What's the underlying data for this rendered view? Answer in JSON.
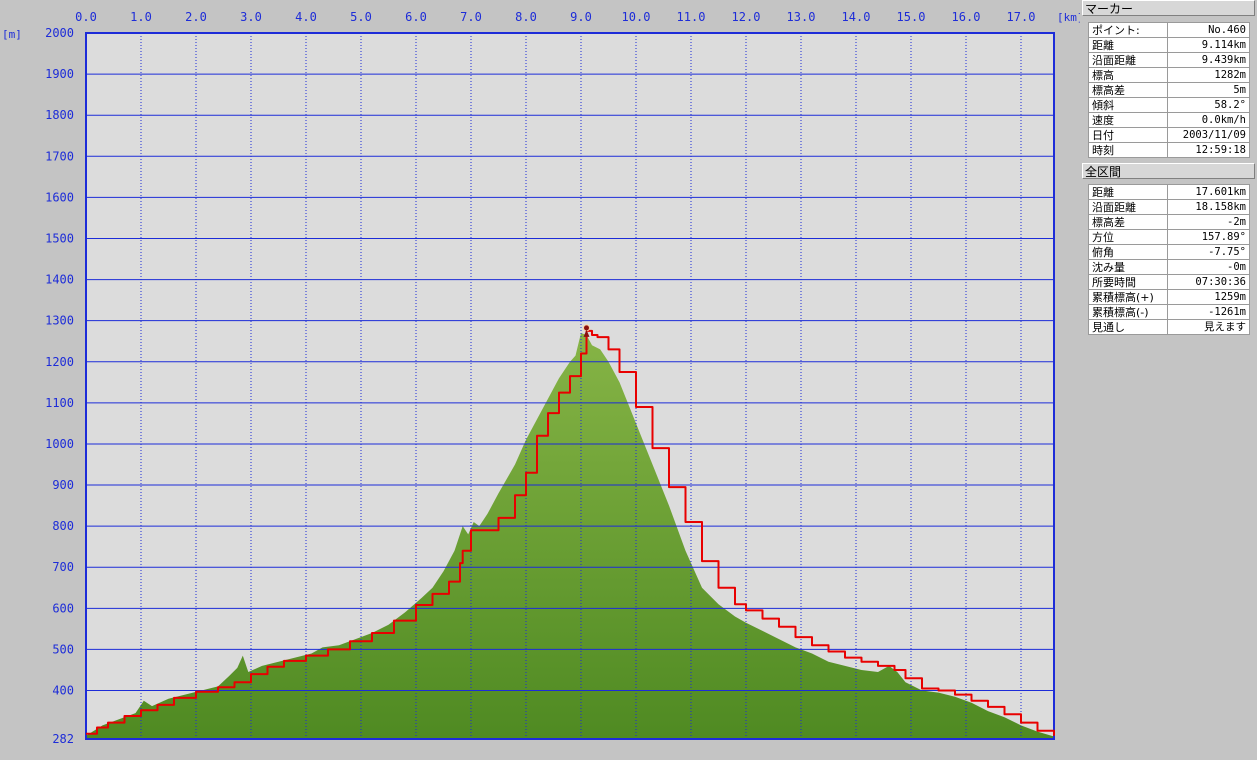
{
  "chart_data": {
    "type": "area",
    "x_unit": "[km]",
    "y_unit": "[m]",
    "xlim": [
      0.0,
      17.6
    ],
    "ylim": [
      282,
      2000
    ],
    "x_ticks": [
      "0.0",
      "1.0",
      "2.0",
      "3.0",
      "4.0",
      "5.0",
      "6.0",
      "7.0",
      "8.0",
      "9.0",
      "10.0",
      "11.0",
      "12.0",
      "13.0",
      "14.0",
      "15.0",
      "16.0",
      "17.0"
    ],
    "y_ticks": [
      "2000",
      "1900",
      "1800",
      "1700",
      "1600",
      "1500",
      "1400",
      "1300",
      "1200",
      "1100",
      "1000",
      "900",
      "800",
      "700",
      "600",
      "500",
      "400",
      "282"
    ],
    "grid": true,
    "terrain": {
      "color": "#5e9530",
      "x": [
        0.0,
        0.3,
        0.6,
        0.9,
        1.05,
        1.2,
        1.5,
        1.8,
        2.1,
        2.4,
        2.6,
        2.75,
        2.85,
        2.95,
        3.2,
        3.5,
        3.8,
        4.1,
        4.3,
        4.6,
        4.9,
        5.2,
        5.5,
        5.8,
        6.1,
        6.3,
        6.5,
        6.7,
        6.85,
        6.95,
        7.05,
        7.15,
        7.3,
        7.5,
        7.8,
        8.0,
        8.2,
        8.4,
        8.6,
        8.8,
        8.9,
        9.0,
        9.1,
        9.2,
        9.35,
        9.5,
        9.7,
        10.0,
        10.3,
        10.6,
        10.9,
        11.2,
        11.5,
        11.8,
        12.0,
        12.3,
        12.6,
        12.9,
        13.2,
        13.5,
        13.8,
        14.1,
        14.4,
        14.6,
        14.75,
        14.9,
        15.2,
        15.5,
        15.8,
        16.1,
        16.4,
        16.7,
        17.0,
        17.3,
        17.6
      ],
      "y": [
        290,
        315,
        330,
        345,
        375,
        362,
        380,
        390,
        400,
        410,
        435,
        455,
        485,
        445,
        460,
        470,
        480,
        490,
        505,
        510,
        525,
        540,
        560,
        590,
        625,
        650,
        690,
        740,
        800,
        780,
        810,
        800,
        830,
        880,
        950,
        1010,
        1060,
        1110,
        1160,
        1200,
        1215,
        1270,
        1265,
        1240,
        1230,
        1200,
        1150,
        1050,
        950,
        850,
        740,
        650,
        610,
        580,
        565,
        545,
        525,
        505,
        490,
        470,
        460,
        450,
        445,
        460,
        445,
        420,
        400,
        395,
        385,
        370,
        350,
        335,
        315,
        300,
        288
      ]
    },
    "series": [
      {
        "color": "#e80000",
        "x": [
          0.0,
          0.2,
          0.4,
          0.7,
          1.0,
          1.3,
          1.6,
          2.0,
          2.4,
          2.7,
          3.0,
          3.3,
          3.6,
          4.0,
          4.4,
          4.8,
          5.2,
          5.6,
          6.0,
          6.3,
          6.6,
          6.8,
          6.85,
          7.0,
          7.2,
          7.5,
          7.8,
          8.0,
          8.2,
          8.4,
          8.6,
          8.8,
          9.0,
          9.1,
          9.2,
          9.3,
          9.5,
          9.7,
          10.0,
          10.3,
          10.6,
          10.9,
          11.2,
          11.5,
          11.8,
          12.0,
          12.3,
          12.6,
          12.9,
          13.2,
          13.5,
          13.8,
          14.1,
          14.4,
          14.7,
          14.9,
          15.2,
          15.5,
          15.8,
          16.1,
          16.4,
          16.7,
          17.0,
          17.3,
          17.6
        ],
        "y": [
          295,
          310,
          322,
          338,
          352,
          365,
          382,
          397,
          408,
          420,
          440,
          458,
          472,
          485,
          500,
          520,
          540,
          570,
          608,
          635,
          665,
          710,
          740,
          790,
          790,
          820,
          875,
          930,
          1020,
          1075,
          1125,
          1165,
          1220,
          1275,
          1265,
          1260,
          1230,
          1175,
          1090,
          990,
          895,
          810,
          715,
          650,
          610,
          595,
          575,
          555,
          530,
          510,
          495,
          480,
          470,
          460,
          450,
          430,
          405,
          400,
          390,
          375,
          360,
          342,
          322,
          302,
          290
        ]
      }
    ]
  },
  "marker_panel": {
    "title": "マーカー",
    "rows": [
      {
        "k": "ポイント:",
        "v": "No.460"
      },
      {
        "k": "距離",
        "v": "9.114km"
      },
      {
        "k": "沿面距離",
        "v": "9.439km"
      },
      {
        "k": "標高",
        "v": "1282m"
      },
      {
        "k": "標高差",
        "v": "5m"
      },
      {
        "k": "傾斜",
        "v": "58.2°"
      },
      {
        "k": "速度",
        "v": "0.0km/h"
      },
      {
        "k": "日付",
        "v": "2003/11/09"
      },
      {
        "k": "時刻",
        "v": "12:59:18"
      }
    ]
  },
  "total_panel": {
    "title": "全区間",
    "rows": [
      {
        "k": "距離",
        "v": "17.601km"
      },
      {
        "k": "沿面距離",
        "v": "18.158km"
      },
      {
        "k": "標高差",
        "v": "-2m"
      },
      {
        "k": "方位",
        "v": "157.89°"
      },
      {
        "k": "俯角",
        "v": "-7.75°"
      },
      {
        "k": "沈み量",
        "v": "-0m"
      },
      {
        "k": "所要時間",
        "v": "07:30:36"
      },
      {
        "k": "累積標高(+)",
        "v": "1259m"
      },
      {
        "k": "累積標高(-)",
        "v": "-1261m"
      },
      {
        "k": "見通し",
        "v": "見えます"
      }
    ]
  },
  "colors": {
    "plot_bg": "#dcdcdc",
    "grid": "#1d2cd8",
    "terrain": "#5e9530",
    "track": "#e80000"
  }
}
